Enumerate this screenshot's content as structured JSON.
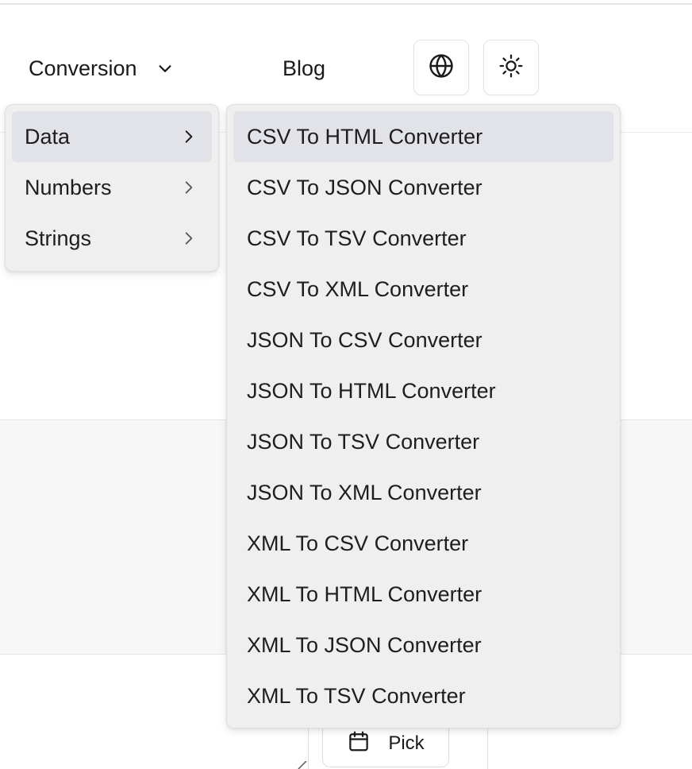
{
  "nav": {
    "conversion_label": "Conversion",
    "conversion_icon": "chevron-down-icon",
    "blog_label": "Blog",
    "language_icon": "globe-icon",
    "theme_icon": "sun-icon"
  },
  "category_menu": {
    "items": [
      {
        "label": "Data",
        "icon": "chevron-right-icon",
        "active": true
      },
      {
        "label": "Numbers",
        "icon": "chevron-right-icon",
        "active": false
      },
      {
        "label": "Strings",
        "icon": "chevron-right-icon",
        "active": false
      }
    ]
  },
  "converter_menu": {
    "items": [
      {
        "label": "CSV To HTML Converter",
        "active": true
      },
      {
        "label": "CSV To JSON Converter",
        "active": false
      },
      {
        "label": "CSV To TSV Converter",
        "active": false
      },
      {
        "label": "CSV To XML Converter",
        "active": false
      },
      {
        "label": "JSON To CSV Converter",
        "active": false
      },
      {
        "label": "JSON To HTML Converter",
        "active": false
      },
      {
        "label": "JSON To TSV Converter",
        "active": false
      },
      {
        "label": "JSON To XML Converter",
        "active": false
      },
      {
        "label": "XML To CSV Converter",
        "active": false
      },
      {
        "label": "XML To HTML Converter",
        "active": false
      },
      {
        "label": "XML To JSON Converter",
        "active": false
      },
      {
        "label": "XML To TSV Converter",
        "active": false
      }
    ]
  },
  "pick_button": {
    "label": "Pick",
    "icon": "calendar-icon"
  },
  "colors": {
    "menu_background": "#efefef",
    "menu_active": "#e1e3e8",
    "text": "#1e1e1e"
  }
}
